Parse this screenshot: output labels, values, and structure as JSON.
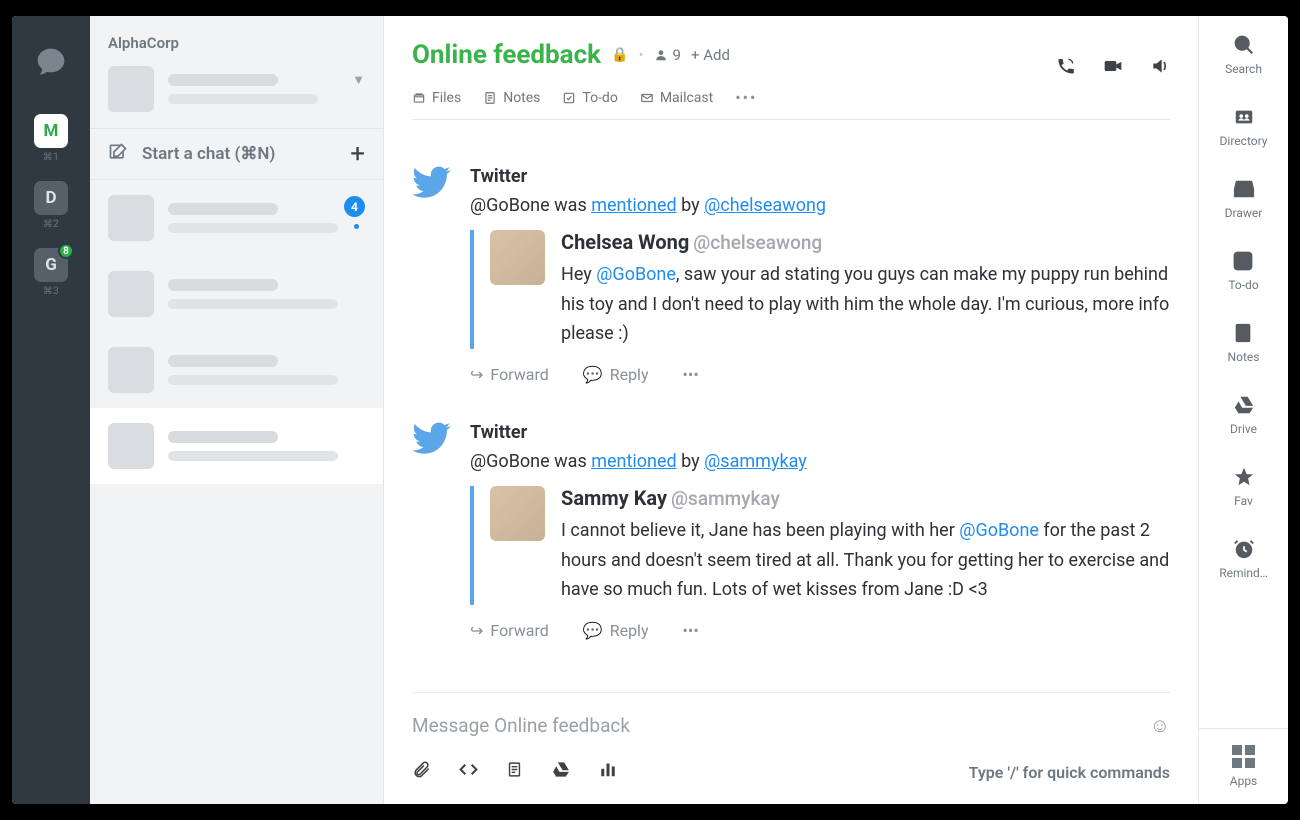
{
  "org_name": "AlphaCorp",
  "rail": {
    "servers": [
      {
        "letter": "M",
        "shortcut": "⌘1",
        "active": true
      },
      {
        "letter": "D",
        "shortcut": "⌘2",
        "active": false
      },
      {
        "letter": "G",
        "shortcut": "⌘3",
        "active": false,
        "badge": "8"
      }
    ]
  },
  "startchat_label": "Start a chat (⌘N)",
  "chatrows": {
    "first_unread": "4"
  },
  "header": {
    "title": "Online feedback",
    "members_count": "9",
    "add_label": "+ Add",
    "tabs": {
      "files": "Files",
      "notes": "Notes",
      "todo": "To-do",
      "mailcast": "Mailcast"
    }
  },
  "composer": {
    "placeholder": "Message Online feedback",
    "hint": "Type '/' for quick commands"
  },
  "rrail": {
    "search": "Search",
    "directory": "Directory",
    "drawer": "Drawer",
    "todo": "To-do",
    "notes": "Notes",
    "drive": "Drive",
    "fav": "Fav",
    "remind": "Remind…",
    "apps": "Apps"
  },
  "posts": [
    {
      "source": "Twitter",
      "meta_prefix": "@GoBone was ",
      "meta_action": "mentioned",
      "meta_by": " by ",
      "meta_user": "@chelseawong",
      "author_name": "Chelsea Wong",
      "author_handle": "@chelseawong",
      "text_a": "Hey ",
      "mention": "@GoBone",
      "text_b": ", saw your ad stating you guys can make my puppy run behind his toy and I don't need to play with him the whole day. I'm curious, more info please :)",
      "forward": "Forward",
      "reply": "Reply"
    },
    {
      "source": "Twitter",
      "meta_prefix": "@GoBone was ",
      "meta_action": "mentioned",
      "meta_by": " by ",
      "meta_user": "@sammykay",
      "author_name": "Sammy Kay",
      "author_handle": "@sammykay",
      "text_a": "I cannot believe it, Jane has been playing with her ",
      "mention": "@GoBone",
      "text_b": " for the past 2 hours and doesn't seem tired at all. Thank you for getting her to exercise and have so much fun. Lots of wet kisses from Jane :D <3",
      "forward": "Forward",
      "reply": "Reply"
    }
  ]
}
